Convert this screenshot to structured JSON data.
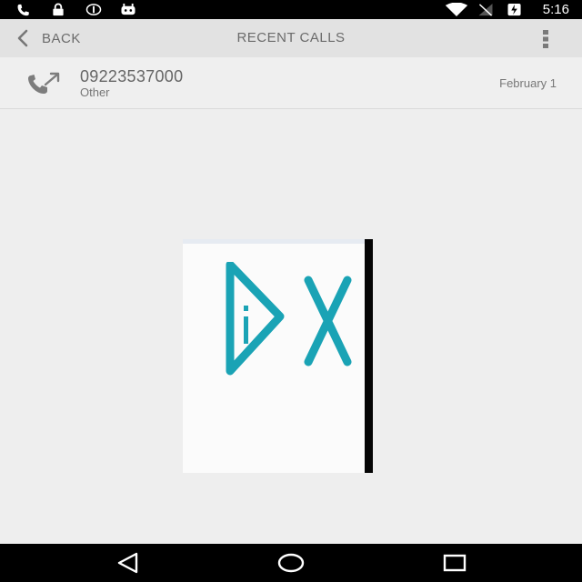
{
  "status_bar": {
    "time": "5:16",
    "left_icons": [
      "phone-icon",
      "lock-icon",
      "circle-icon",
      "android-icon"
    ],
    "right_icons": [
      "wifi-icon",
      "signal-icon",
      "battery-charging-icon"
    ]
  },
  "toolbar": {
    "back_label": "BACK",
    "title": "RECENT CALLS",
    "overflow_icon": "more-vert-icon"
  },
  "call_log": [
    {
      "number": "09223537000",
      "type": "Other",
      "date": "February 1",
      "icon": "outgoing-call-icon"
    }
  ],
  "colors": {
    "accent": "#1aa3b5",
    "background": "#eeeeee",
    "toolbar": "#e2e2e2"
  },
  "nav_bar": {
    "icons": [
      "back-triangle-icon",
      "home-circle-icon",
      "recents-square-icon"
    ]
  }
}
